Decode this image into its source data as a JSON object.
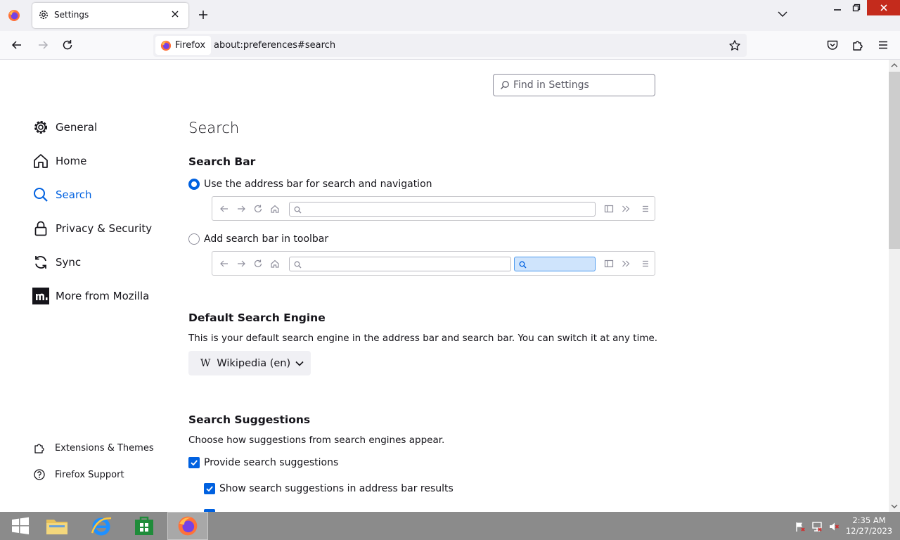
{
  "browser": {
    "tab_title": "Settings",
    "identity_label": "Firefox",
    "url": "about:preferences#search"
  },
  "settings": {
    "find_placeholder": "Find in Settings",
    "categories": [
      {
        "label": "General",
        "icon": "gear-icon"
      },
      {
        "label": "Home",
        "icon": "home-icon"
      },
      {
        "label": "Search",
        "icon": "search-icon",
        "selected": true
      },
      {
        "label": "Privacy & Security",
        "icon": "lock-icon"
      },
      {
        "label": "Sync",
        "icon": "sync-icon"
      },
      {
        "label": "More from Mozilla",
        "icon": "mozilla-icon"
      }
    ],
    "footer_links": [
      {
        "label": "Extensions & Themes",
        "icon": "puzzle-icon"
      },
      {
        "label": "Firefox Support",
        "icon": "help-icon"
      }
    ]
  },
  "page": {
    "title": "Search",
    "search_bar": {
      "heading": "Search Bar",
      "option_address_bar": "Use the address bar for search and navigation",
      "option_toolbar": "Add search bar in toolbar",
      "selected": "address_bar"
    },
    "default_engine": {
      "heading": "Default Search Engine",
      "description": "This is your default search engine in the address bar and search bar. You can switch it at any time.",
      "engine_icon_glyph": "W",
      "engine": "Wikipedia (en)"
    },
    "suggestions": {
      "heading": "Search Suggestions",
      "description": "Choose how suggestions from search engines appear.",
      "provide_label": "Provide search suggestions",
      "provide_checked": true,
      "show_in_address_bar_label": "Show search suggestions in address bar results",
      "show_in_address_bar_checked": true
    }
  },
  "taskbar": {
    "time": "2:35 AM",
    "date": "12/27/2023"
  },
  "colors": {
    "accent": "#0061e0",
    "close_red": "#c42b1c",
    "taskbar": "#8b8b8b"
  }
}
